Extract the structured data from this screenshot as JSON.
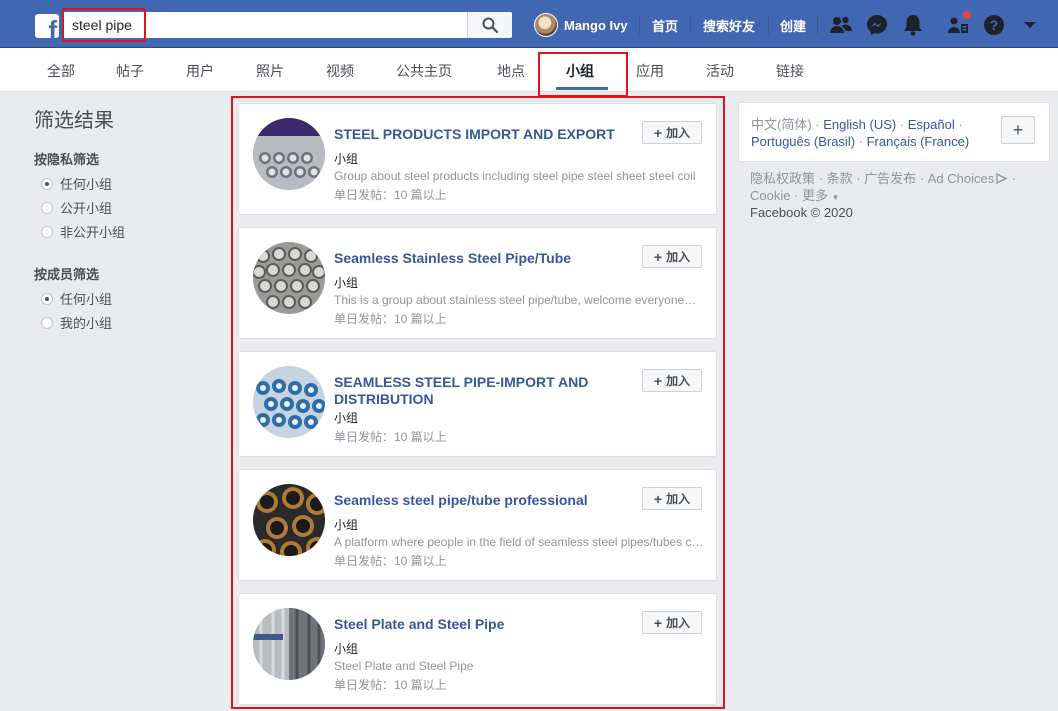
{
  "header": {
    "search_value": "steel pipe",
    "user_name": "Mango Ivy",
    "links": [
      "首页",
      "搜索好友",
      "创建"
    ],
    "icons": [
      "friends-icon",
      "messenger-icon",
      "notifications-icon",
      "groups-icon",
      "help-icon",
      "menu-caret-icon"
    ],
    "brand_color": "#4267b2"
  },
  "tabs": [
    "全部",
    "帖子",
    "用户",
    "照片",
    "视频",
    "公共主页",
    "地点",
    "小组",
    "应用",
    "活动",
    "链接"
  ],
  "active_tab": "小组",
  "filters": {
    "title": "筛选结果",
    "privacy": {
      "label": "按隐私筛选",
      "options": [
        "任何小组",
        "公开小组",
        "非公开小组"
      ],
      "selected": "任何小组"
    },
    "membership": {
      "label": "按成员筛选",
      "options": [
        "任何小组",
        "我的小组"
      ],
      "selected": "任何小组"
    }
  },
  "results": [
    {
      "title": "STEEL PRODUCTS IMPORT AND EXPORT",
      "type": "小组",
      "description": "Group about steel products including steel pipe steel sheet steel coil",
      "activity": "单日发帖：10 篇以上",
      "join_label": "加入"
    },
    {
      "title": "Seamless Stainless Steel Pipe/Tube",
      "type": "小组",
      "description": "This is a group about stainless steel pipe/tube, welcome everyone to join",
      "activity": "单日发帖：10 篇以上",
      "join_label": "加入"
    },
    {
      "title": "SEAMLESS STEEL PIPE-IMPORT AND DISTRIBUTION",
      "type": "小组",
      "description": "",
      "activity": "单日发帖：10 篇以上",
      "join_label": "加入"
    },
    {
      "title": "Seamless steel pipe/tube professional",
      "type": "小组",
      "description": "A platform where people in the field of seamless steel pipes/tubes communicate",
      "activity": "单日发帖：10 篇以上",
      "join_label": "加入"
    },
    {
      "title": "Steel Plate and Steel Pipe",
      "type": "小组",
      "description": "Steel Plate and Steel Pipe",
      "activity": "单日发帖：10 篇以上",
      "join_label": "加入"
    }
  ],
  "sidebar": {
    "current_language": "中文(简体)",
    "languages": [
      "English (US)",
      "Español",
      "Português (Brasil)",
      "Français (France)"
    ],
    "add_label": "+",
    "footer_links": [
      "隐私权政策",
      "条款",
      "广告发布",
      "Ad Choices",
      "Cookie",
      "更多"
    ],
    "copyright": "Facebook © 2020"
  }
}
